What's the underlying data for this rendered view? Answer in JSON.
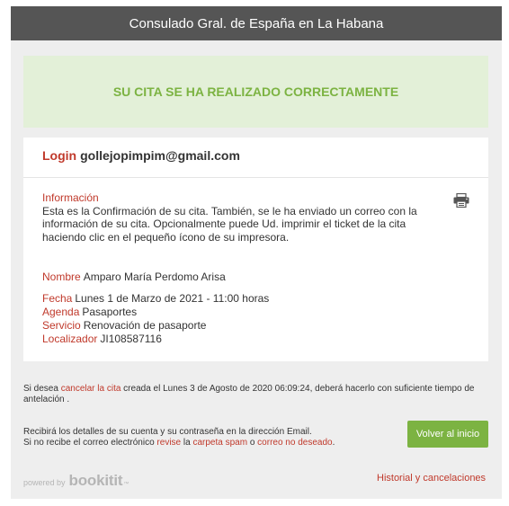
{
  "header": {
    "title": "Consulado Gral. de España en La Habana"
  },
  "banner": {
    "message": "SU CITA SE HA REALIZADO CORRECTAMENTE"
  },
  "login": {
    "label": "Login",
    "email": "gollejopimpim@gmail.com"
  },
  "info": {
    "label": "Información",
    "text": "Esta es la Confirmación de su cita. También, se le ha enviado un correo con la información de su cita. Opcionalmente puede Ud. imprimir el ticket de la cita haciendo clic en el pequeño ícono de su impresora.",
    "print_icon": "printer-icon"
  },
  "details": {
    "nombre_label": "Nombre",
    "nombre_value": "Amparo María Perdomo Arisa",
    "fecha_label": "Fecha",
    "fecha_value": "Lunes 1 de Marzo de 2021 - 11:00 horas",
    "agenda_label": "Agenda",
    "agenda_value": "Pasaportes",
    "servicio_label": "Servicio",
    "servicio_value": "Renovación de pasaporte",
    "localizador_label": "Localizador",
    "localizador_value": "JI108587116"
  },
  "cancel_note": {
    "prefix": "Si desea ",
    "link": "cancelar la cita",
    "suffix": " creada el Lunes 3 de Agosto de 2020 06:09:24, deberá hacerlo con suficiente tiempo de antelación ."
  },
  "email_note": {
    "line1": "Recibirá los detalles de su cuenta y su contraseña en la dirección Email.",
    "line2_prefix": "Si no recibe el correo electrónico ",
    "link1": "revise",
    "mid1": " la ",
    "link2": "carpeta spam",
    "mid2": " o ",
    "link3": "correo no deseado",
    "end": "."
  },
  "actions": {
    "back_label": "Volver al inicio",
    "history_label": "Historial y cancelaciones"
  },
  "footer": {
    "powered_by": "powered by",
    "brand": "bookitit",
    "brand_mark": "™"
  },
  "colors": {
    "header_bg": "#555555",
    "accent_green": "#7cb342",
    "banner_bg": "#e3f0d8",
    "label_red": "#c0392b",
    "page_bg": "#eeeeee"
  }
}
